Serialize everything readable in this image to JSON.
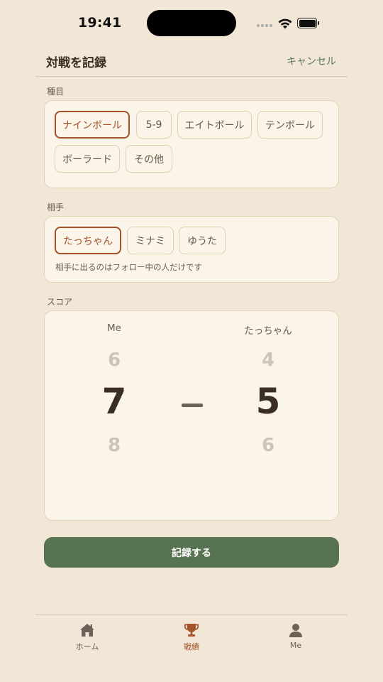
{
  "status_bar": {
    "time": "19:41"
  },
  "header": {
    "title": "対戦を記録",
    "cancel_label": "キャンセル"
  },
  "game_type": {
    "label": "種目",
    "options": [
      "ナインボール",
      "5-9",
      "エイトボール",
      "テンボール",
      "ボーラード",
      "その他"
    ],
    "selected": "ナインボール"
  },
  "opponent": {
    "label": "相手",
    "options": [
      "たっちゃん",
      "ミナミ",
      "ゆうた"
    ],
    "selected": "たっちゃん",
    "hint": "相手に出るのはフォロー中の人だけです"
  },
  "score": {
    "label": "スコア",
    "me": {
      "name": "Me",
      "prev": "6",
      "value": "7",
      "next": "8"
    },
    "opponent": {
      "name": "たっちゃん",
      "prev": "4",
      "value": "5",
      "next": "6"
    }
  },
  "submit_label": "記録する",
  "tabbar": {
    "items": [
      {
        "label": "ホーム",
        "icon": "home-icon",
        "active": false
      },
      {
        "label": "戦績",
        "icon": "trophy-icon",
        "active": true
      },
      {
        "label": "Me",
        "icon": "person-icon",
        "active": false
      }
    ]
  },
  "colors": {
    "background": "#f2e7d7",
    "accent": "#a3522a",
    "primary_button": "#577352",
    "link": "#5a7a56"
  }
}
